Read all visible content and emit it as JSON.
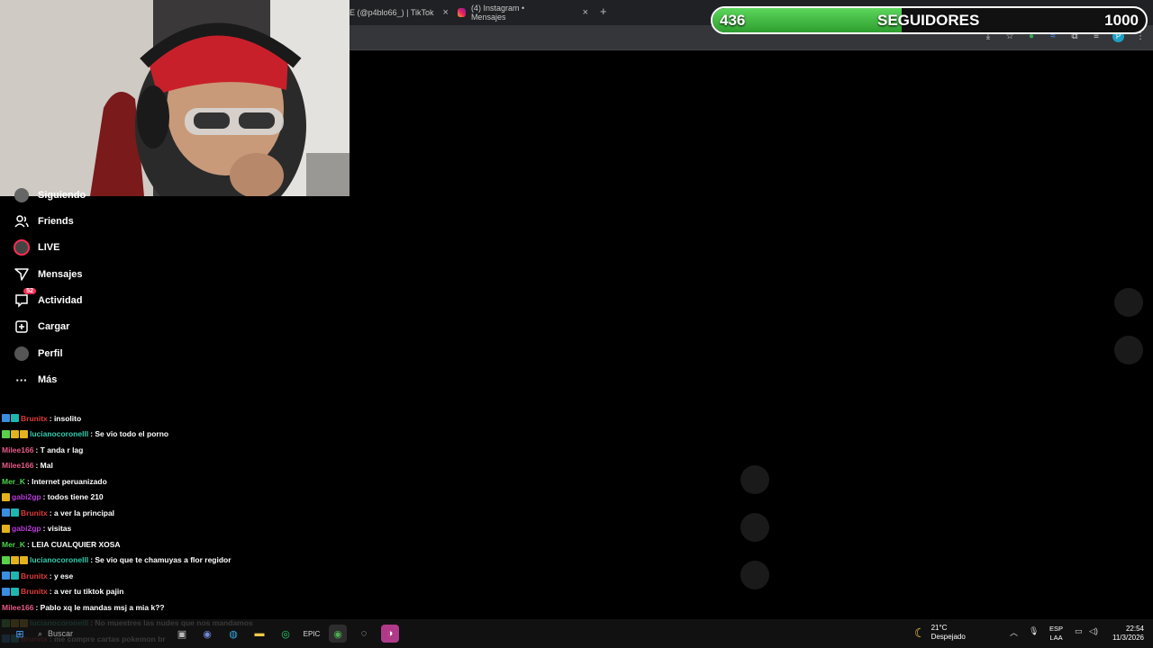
{
  "browser": {
    "tabs": [
      {
        "label": "E (@p4blo66_) | TikTok"
      },
      {
        "label": "(4) Instagram • Mensajes"
      }
    ],
    "new_tab": "+",
    "close": "×"
  },
  "goal": {
    "current": "436",
    "label": "SEGUIDORES",
    "target": "1000",
    "progress": 0.436
  },
  "sidebar": {
    "items": [
      {
        "label": "Siguiendo",
        "icon": "following-avatar-icon"
      },
      {
        "label": "Friends",
        "icon": "friends-icon"
      },
      {
        "label": "LIVE",
        "icon": "live-icon"
      },
      {
        "label": "Mensajes",
        "icon": "send-icon"
      },
      {
        "label": "Actividad",
        "icon": "activity-icon",
        "badge": "52"
      },
      {
        "label": "Cargar",
        "icon": "upload-icon"
      },
      {
        "label": "Perfil",
        "icon": "profile-avatar-icon"
      },
      {
        "label": "Más",
        "icon": "more-icon"
      }
    ]
  },
  "chat": {
    "messages": [
      {
        "user": "Brunitx",
        "user_color": "#e03b3b",
        "text": ": insolito",
        "badges": [
          "blue",
          "teal"
        ]
      },
      {
        "user": "lucianocoronelll",
        "user_color": "#2fd0b0",
        "text": ": Se vio todo el porno",
        "badges": [
          "green",
          "gold",
          "gold"
        ]
      },
      {
        "user": "Milee166",
        "user_color": "#e85a8a",
        "text": ": T anda r lag",
        "badges": []
      },
      {
        "user": "Milee166",
        "user_color": "#e85a8a",
        "text": ": Mal",
        "badges": []
      },
      {
        "user": "Mer_K",
        "user_color": "#4fd34f",
        "text": ": Internet peruanizado",
        "badges": []
      },
      {
        "user": "gabi2gp",
        "user_color": "#b93bdc",
        "text": ": todos tiene 210",
        "badges": [
          "gold"
        ]
      },
      {
        "user": "Brunitx",
        "user_color": "#e03b3b",
        "text": ": a ver la principal",
        "badges": [
          "blue",
          "teal"
        ]
      },
      {
        "user": "gabi2gp",
        "user_color": "#b93bdc",
        "text": ": visitas",
        "badges": [
          "gold"
        ]
      },
      {
        "user": "Mer_K",
        "user_color": "#4fd34f",
        "text": ": LEIA CUALQUIER XOSA",
        "badges": []
      },
      {
        "user": "lucianocoronelll",
        "user_color": "#2fd0b0",
        "text": ": Se vio que te chamuyas a flor regidor",
        "badges": [
          "green",
          "gold",
          "gold"
        ]
      },
      {
        "user": "Brunitx",
        "user_color": "#e03b3b",
        "text": ": y ese",
        "badges": [
          "blue",
          "teal"
        ]
      },
      {
        "user": "Brunitx",
        "user_color": "#e03b3b",
        "text": ": a ver tu tiktok pajin",
        "badges": [
          "blue",
          "teal"
        ]
      },
      {
        "user": "Milee166",
        "user_color": "#e85a8a",
        "text": ": Pablo xq le mandas msj a mia k??",
        "badges": []
      },
      {
        "user": "lucianocoronelll",
        "user_color": "#2fd0b0",
        "text": ": No muestres las nudes que nos mandamos",
        "badges": [
          "green",
          "gold",
          "gold"
        ]
      },
      {
        "user": "Brunitx",
        "user_color": "#e03b3b",
        "text": ": me compre cartas pokemon br",
        "badges": [
          "blue",
          "teal"
        ]
      }
    ]
  },
  "taskbar": {
    "search": "Buscar",
    "weather_temp": "21°C",
    "weather_desc": "Despejado",
    "lang_top": "ESP",
    "lang_bottom": "LAA",
    "time": "22:54",
    "date": "11/3/2026"
  }
}
